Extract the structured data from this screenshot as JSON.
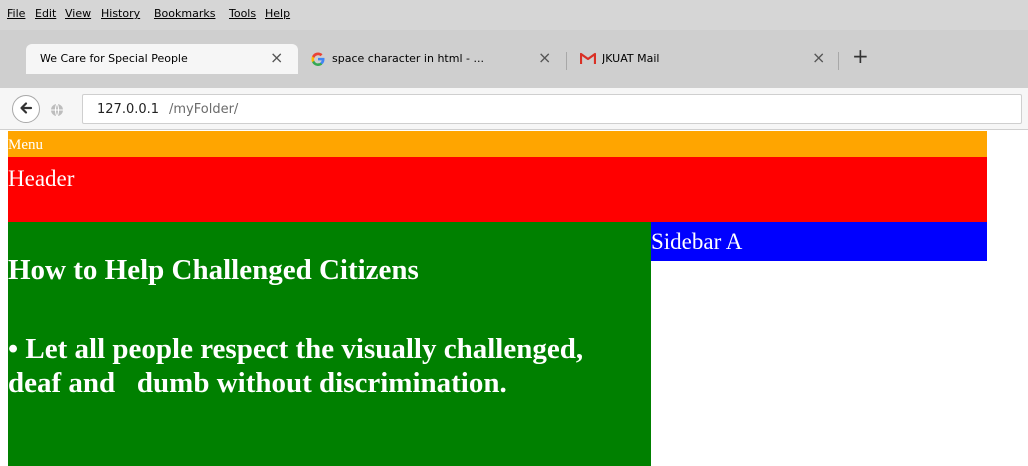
{
  "browser": {
    "menu": [
      "File",
      "Edit",
      "View",
      "History",
      "Bookmarks",
      "Tools",
      "Help"
    ],
    "tabs": [
      {
        "title": "We Care for Special People",
        "close": "×",
        "active": true
      },
      {
        "title": "space character in html - ...",
        "close": "×",
        "active": false,
        "icon": "google-icon"
      },
      {
        "title": "JKUAT Mail",
        "close": "×",
        "active": false,
        "icon": "gmail-icon"
      }
    ],
    "new_tab": "+",
    "url_host": "127.0.0.1",
    "url_path": "/myFolder/",
    "accent_colors": {
      "google_blue": "#4285f4",
      "gmail_red": "#d93025"
    }
  },
  "page": {
    "menu": "Menu",
    "header": "Header",
    "sidebar": "Sidebar A",
    "main_heading": "How to Help Challenged Citizens",
    "main_bullet": "• Let all people respect the visually challenged, deaf and   dumb without discrimination.",
    "colors": {
      "menu": "#ffa500",
      "header": "#ff0000",
      "main": "#008000",
      "sidebar": "#0000ff"
    }
  }
}
